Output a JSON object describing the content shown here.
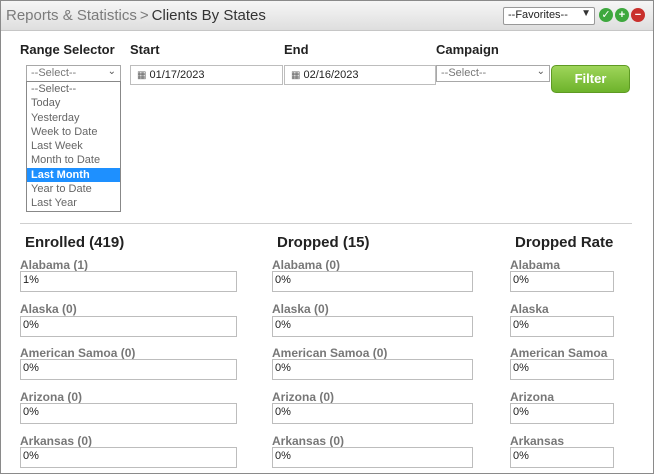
{
  "header": {
    "breadcrumb_parent": "Reports & Statistics",
    "breadcrumb_separator": ">",
    "page_title": "Clients By States",
    "favorites_value": "--Favorites--",
    "icons": [
      "check-icon",
      "plus-icon",
      "minus-icon"
    ]
  },
  "filters": {
    "range_label": "Range Selector",
    "range_value": "--Select--",
    "range_options": [
      "--Select--",
      "Today",
      "Yesterday",
      "Week to Date",
      "Last Week",
      "Month to Date",
      "Last Month",
      "Year to Date",
      "Last Year"
    ],
    "range_selected": "Last Month",
    "start_label": "Start",
    "start_value": "01/17/2023",
    "end_label": "End",
    "end_value": "02/16/2023",
    "campaign_label": "Campaign",
    "campaign_value": "--Select--",
    "filter_button": "Filter"
  },
  "columns": {
    "enrolled_title": "Enrolled (419)",
    "dropped_title": "Dropped (15)",
    "rate_title": "Dropped Rate"
  },
  "rows": [
    {
      "enrolled_label": "Alabama (1)",
      "enrolled_value": "1%",
      "dropped_label": "Alabama (0)",
      "dropped_value": "0%",
      "rate_label": "Alabama",
      "rate_value": "0%"
    },
    {
      "enrolled_label": "Alaska (0)",
      "enrolled_value": "0%",
      "dropped_label": "Alaska (0)",
      "dropped_value": "0%",
      "rate_label": "Alaska",
      "rate_value": "0%"
    },
    {
      "enrolled_label": "American Samoa (0)",
      "enrolled_value": "0%",
      "dropped_label": "American Samoa (0)",
      "dropped_value": "0%",
      "rate_label": "American Samoa",
      "rate_value": "0%"
    },
    {
      "enrolled_label": "Arizona (0)",
      "enrolled_value": "0%",
      "dropped_label": "Arizona (0)",
      "dropped_value": "0%",
      "rate_label": "Arizona",
      "rate_value": "0%"
    },
    {
      "enrolled_label": "Arkansas (0)",
      "enrolled_value": "0%",
      "dropped_label": "Arkansas (0)",
      "dropped_value": "0%",
      "rate_label": "Arkansas",
      "rate_value": "0%"
    }
  ],
  "colors": {
    "filter_button": "#7cc23a",
    "selected_option": "#1e90ff",
    "ok_icon": "#3ea83e",
    "remove_icon": "#c9302c"
  }
}
